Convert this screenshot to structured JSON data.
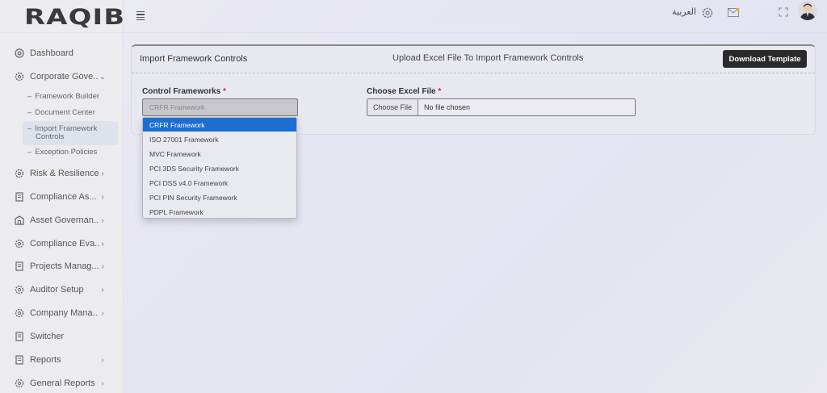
{
  "app": {
    "logo": "RAQIB"
  },
  "topbar": {
    "language": "العربية"
  },
  "sidebar": {
    "items": [
      {
        "label": "Dashboard",
        "icon": "dashboard-icon",
        "chevron": ""
      },
      {
        "label": "Corporate Gove...",
        "icon": "gear-icon",
        "chevron": "⌄"
      },
      {
        "label": "Risk & Resilience",
        "icon": "gear-icon",
        "chevron": "›"
      },
      {
        "label": "Compliance As...",
        "icon": "document-icon",
        "chevron": "›"
      },
      {
        "label": "Asset Governan...",
        "icon": "building-icon",
        "chevron": "›"
      },
      {
        "label": "Compliance Eva...",
        "icon": "gear-icon",
        "chevron": "›"
      },
      {
        "label": "Projects Manag...",
        "icon": "document-icon",
        "chevron": "›"
      },
      {
        "label": "Auditor Setup",
        "icon": "gear-icon",
        "chevron": "›"
      },
      {
        "label": "Company Mana...",
        "icon": "gear-icon",
        "chevron": "›"
      },
      {
        "label": "Switcher",
        "icon": "document-icon",
        "chevron": ""
      },
      {
        "label": "Reports",
        "icon": "document-icon",
        "chevron": "›"
      },
      {
        "label": "General Reports",
        "icon": "gear-icon",
        "chevron": "›"
      }
    ],
    "subitems": [
      {
        "label": "Framework Builder"
      },
      {
        "label": "Document Center"
      },
      {
        "label": "Import Framework",
        "label2": "Controls"
      },
      {
        "label": "Exception Policies"
      }
    ],
    "sub_dash": "–"
  },
  "card": {
    "title": "Import Framework Controls",
    "subtitle": "Upload Excel File To Import Framework Controls",
    "download_label": "Download Template",
    "control_label": "Control Frameworks",
    "required_mark": "*",
    "select_value": "CRFR Framework",
    "file_label": "Choose Excel File",
    "file_button": "Choose File",
    "file_status": "No file chosen"
  },
  "dropdown": {
    "options": [
      "CRFR Framework",
      "ISO 27001 Framework",
      "MVC Framework",
      "PCI 3DS Security Framework",
      "PCI DSS v4.0 Framework",
      "PCI PIN Security Framework",
      "PDPL Framework"
    ],
    "selected": "CRFR Framework"
  },
  "colors": {
    "accent": "#1c6fd1",
    "required": "#dd2233",
    "button_dark": "#2a2a2a"
  }
}
